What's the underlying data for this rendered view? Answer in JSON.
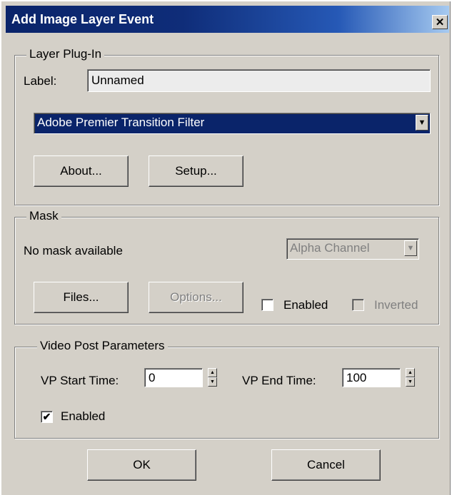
{
  "window": {
    "title": "Add Image Layer Event",
    "close_glyph": "✕"
  },
  "layer_plugin": {
    "group_label": "Layer Plug-In",
    "label_caption": "Label:",
    "label_value": "Unnamed",
    "plugin_selected": "Adobe Premier Transition Filter",
    "about_button": "About...",
    "setup_button": "Setup..."
  },
  "mask": {
    "group_label": "Mask",
    "status_text": "No mask available",
    "channel_selected": "Alpha Channel",
    "files_button": "Files...",
    "options_button": "Options...",
    "enabled_label": "Enabled",
    "inverted_label": "Inverted",
    "enabled_checked": false,
    "inverted_checked": false
  },
  "vp_params": {
    "group_label": "Video Post Parameters",
    "start_label": "VP Start Time:",
    "start_value": "0",
    "end_label": "VP End Time:",
    "end_value": "100",
    "enabled_label": "Enabled",
    "enabled_checked": true,
    "check_glyph": "✔"
  },
  "footer": {
    "ok_button": "OK",
    "cancel_button": "Cancel"
  },
  "colors": {
    "title_bar": "#0a246a",
    "dialog_face": "#d4d0c8",
    "selection": "#0a246a"
  }
}
